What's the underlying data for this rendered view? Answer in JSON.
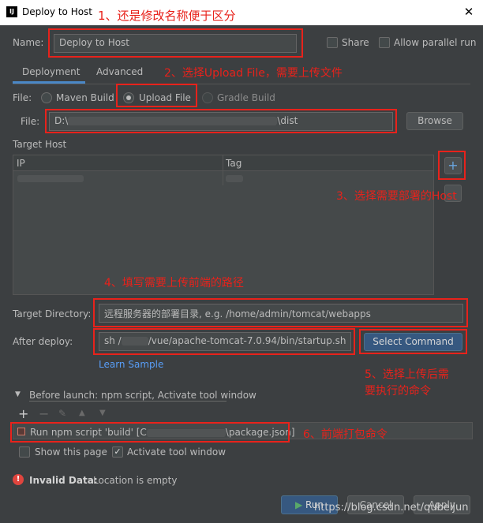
{
  "window": {
    "title": "Deploy to Host",
    "logo": "IJ"
  },
  "name_row": {
    "label": "Name:",
    "value": "Deploy to Host",
    "share_label": "Share",
    "allow_parallel_label": "Allow parallel run"
  },
  "tabs": [
    {
      "label": "Deployment",
      "selected": true
    },
    {
      "label": "Advanced",
      "selected": false
    }
  ],
  "file_row": {
    "label": "File:",
    "options": [
      "Maven Build",
      "Upload File",
      "Gradle Build"
    ],
    "selected": "Upload File"
  },
  "file_path": {
    "label": "File:",
    "prefix": "D:\\",
    "suffix": "\\dist",
    "browse_label": "Browse"
  },
  "target_host": {
    "label": "Target Host",
    "columns": [
      "IP",
      "Tag"
    ]
  },
  "target_directory": {
    "label": "Target Directory:",
    "value": "远程服务器的部署目录, e.g. /home/admin/tomcat/webapps"
  },
  "after_deploy": {
    "label": "After deploy:",
    "value_prefix": "sh /",
    "value_suffix": "/vue/apache-tomcat-7.0.94/bin/startup.sh",
    "select_command_label": "Select Command",
    "learn_sample": "Learn Sample"
  },
  "before_launch": {
    "label": "Before launch: npm script, Activate tool window",
    "item_prefix": "Run npm script 'build' [C",
    "item_suffix": "\\package.json]"
  },
  "options": {
    "show_page_label": "Show this page",
    "show_page_checked": false,
    "activate_label": "Activate tool window",
    "activate_checked": true
  },
  "error": {
    "label": "Invalid Data:",
    "message": "Location is empty"
  },
  "footer": {
    "run_label": "Run",
    "cancel_label": "Cancel",
    "apply_label": "Apply",
    "watermark": "https://blog.csdn.net/qubeijun"
  },
  "annotations": {
    "a1": "1、还是修改名称便于区分",
    "a2": "2、选择Upload File，需要上传文件",
    "a3": "3、选择需要部署的Host",
    "a4": "4、填写需要上传前端的路径",
    "a5_line1": "5、选择上传后需",
    "a5_line2": "要执行的命令",
    "a6": "6、前端打包命令"
  },
  "colors": {
    "background": "#3c3f41",
    "annotation_red": "#e8221b",
    "accent_blue": "#4a88c7",
    "error_red": "#e0453e",
    "run_green": "#59a869"
  }
}
